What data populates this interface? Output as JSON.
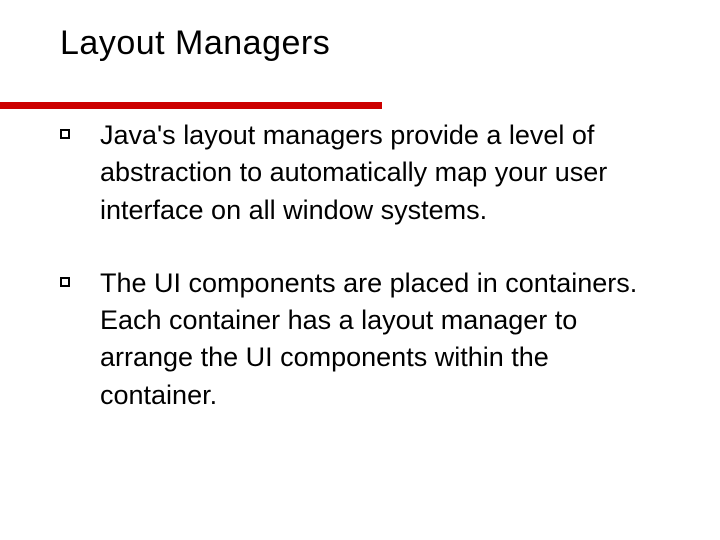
{
  "slide": {
    "title": "Layout Managers",
    "bullets": [
      "Java's layout managers provide a level of abstraction to automatically map your user interface on all window systems.",
      "The UI components are placed in containers.  Each container has a layout manager to arrange the UI components within the container."
    ]
  }
}
